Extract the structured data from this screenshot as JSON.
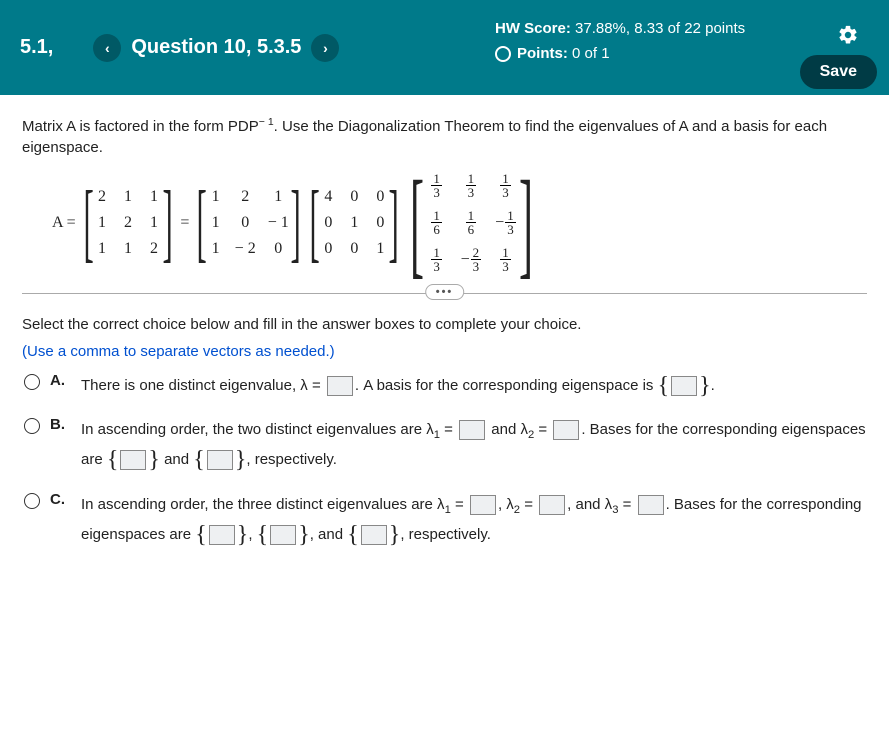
{
  "header": {
    "crumb": "5.1,",
    "question_title": "Question 10, 5.3.5",
    "hw_score_label": "HW Score:",
    "hw_score_value": "37.88%, 8.33 of 22 points",
    "points_label": "Points:",
    "points_value": "0 of 1",
    "save": "Save"
  },
  "problem": {
    "instr_pre": "Matrix A is factored in the form PDP",
    "instr_exp": "− 1",
    "instr_post": ". Use the Diagonalization Theorem to find the eigenvalues of A and a basis for each eigenspace.",
    "A_label": "A =",
    "eq": "=",
    "matrix_A": [
      [
        "2",
        "1",
        "1"
      ],
      [
        "1",
        "2",
        "1"
      ],
      [
        "1",
        "1",
        "2"
      ]
    ],
    "matrix_P": [
      [
        "1",
        "2",
        "1"
      ],
      [
        "1",
        "0",
        "− 1"
      ],
      [
        "1",
        "− 2",
        "0"
      ]
    ],
    "matrix_D": [
      [
        "4",
        "0",
        "0"
      ],
      [
        "0",
        "1",
        "0"
      ],
      [
        "0",
        "0",
        "1"
      ]
    ],
    "matrix_Pinv": [
      [
        {
          "n": "1",
          "d": "3",
          "s": ""
        },
        {
          "n": "1",
          "d": "3",
          "s": ""
        },
        {
          "n": "1",
          "d": "3",
          "s": ""
        }
      ],
      [
        {
          "n": "1",
          "d": "6",
          "s": ""
        },
        {
          "n": "1",
          "d": "6",
          "s": ""
        },
        {
          "n": "1",
          "d": "3",
          "s": "−"
        }
      ],
      [
        {
          "n": "1",
          "d": "3",
          "s": ""
        },
        {
          "n": "2",
          "d": "3",
          "s": "−"
        },
        {
          "n": "1",
          "d": "3",
          "s": ""
        }
      ]
    ]
  },
  "question": {
    "prompt": "Select the correct choice below and fill in the answer boxes to complete your choice.",
    "hint": "(Use a comma to separate vectors as needed.)",
    "A": {
      "label": "A.",
      "t1": "There is one distinct eigenvalue, λ =",
      "t2": ". A basis for the corresponding eigenspace is",
      "t3": "."
    },
    "B": {
      "label": "B.",
      "t1": "In ascending order, the two distinct eigenvalues are λ",
      "sub1": "1",
      "t2": " =",
      "t3": " and λ",
      "sub2": "2",
      "t4": " =",
      "t5": ". Bases for the corresponding eigenspaces are",
      "t6": " and",
      "t7": ", respectively."
    },
    "C": {
      "label": "C.",
      "t1": "In ascending order, the three distinct eigenvalues are λ",
      "sub1": "1",
      "t2": " =",
      "t3": ", λ",
      "sub2": "2",
      "t4": " =",
      "t5": ", and λ",
      "sub3": "3",
      "t6": " =",
      "t7": ". Bases for the corresponding eigenspaces are",
      "t8": ",",
      "t9": ", and",
      "t10": ", respectively."
    }
  }
}
